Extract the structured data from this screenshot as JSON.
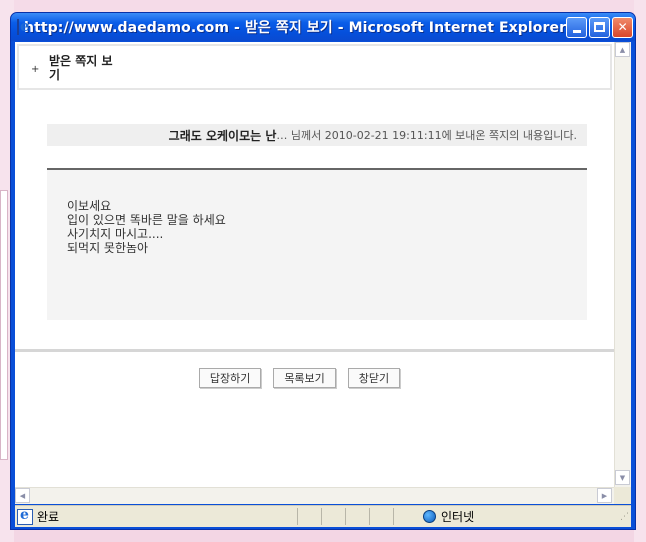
{
  "window": {
    "title": "http://www.daedamo.com - 받은 쪽지 보기 - Microsoft Internet Explorer",
    "minimize_icon": "minimize-icon",
    "maximize_icon": "maximize-icon",
    "close_icon": "close-icon"
  },
  "page": {
    "header_plus": "+",
    "header_title": "받은 쪽지 보기",
    "info": {
      "sender": "그래도 오케이모는 난",
      "ellipsis": "…",
      "suffix": " 님께서 2010-02-21 19:11:11에 보내온 쪽지의 내용입니다."
    },
    "message_lines": [
      "이보세요",
      "입이 있으면 똑바른 말을 하세요",
      "사기치지 마시고....",
      "되먹지 못한놈아"
    ],
    "buttons": {
      "reply": "답장하기",
      "list": "목록보기",
      "close": "창닫기"
    }
  },
  "statusbar": {
    "status": "완료",
    "zone": "인터넷"
  },
  "colors": {
    "titlebar": "#0a5de8",
    "statusbar": "#ece9d8",
    "page_bg": "#ffffff"
  }
}
